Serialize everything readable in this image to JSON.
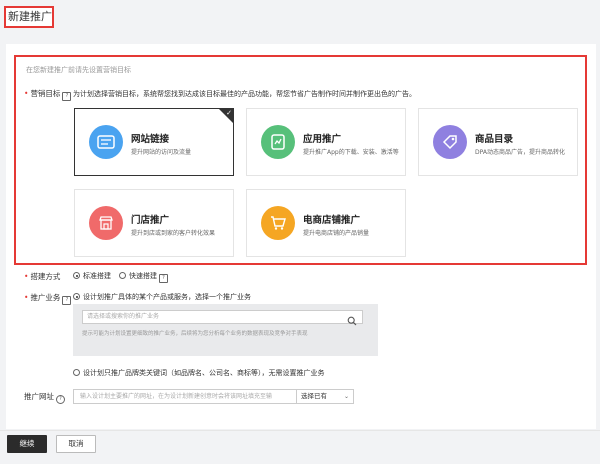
{
  "page": {
    "title": "新建推广"
  },
  "objective": {
    "hint": "在您新建推广前请先设置营销目标",
    "label": "营销目标",
    "description": "为计划选择营销目标，系统帮您找到达成该目标最佳的产品功能，帮您节省广告制作时间并制作更出色的广告。",
    "cards": [
      {
        "title": "网站链接",
        "subtitle": "提升网站的访问及流量",
        "icon": "link-icon",
        "color": "#4aa3f0",
        "selected": true
      },
      {
        "title": "应用推广",
        "subtitle": "提升推广App的下载、安装、激活等",
        "icon": "app-icon",
        "color": "#57c07a",
        "selected": false
      },
      {
        "title": "商品目录",
        "subtitle": "DPA动态商品广告，提升商品转化",
        "icon": "tag-icon",
        "color": "#8f80e0",
        "selected": false
      },
      {
        "title": "门店推广",
        "subtitle": "提升到店或到家的客户转化效果",
        "icon": "store-icon",
        "color": "#f06a6a",
        "selected": false
      },
      {
        "title": "电商店铺推广",
        "subtitle": "提升电商店铺的产品销量",
        "icon": "cart-icon",
        "color": "#f5a623",
        "selected": false
      }
    ]
  },
  "build_method": {
    "label": "搭建方式",
    "options": [
      "标准搭建",
      "快速搭建"
    ],
    "selected": "标准搭建"
  },
  "business": {
    "label": "推广业务",
    "option1": "设计划推广具体的某个产品或服务，选择一个推广业务",
    "search_placeholder": "请选择或搜索你的推广业务",
    "hint": "提示可能为计划设置更细致的推广业务，后续将为您分析每个业务的数据表现及竞争对手表现",
    "option2": "设计划只推广品牌类关键词（如品牌名、公司名、商标等），无需设置推广业务"
  },
  "url": {
    "label": "推广网址",
    "placeholder": "输入设计划主要推广的网址，在为设计划新建创意时会将该网址填充至输",
    "select_label": "选择已有"
  },
  "footer": {
    "continue_label": "继续",
    "cancel_label": "取消"
  }
}
